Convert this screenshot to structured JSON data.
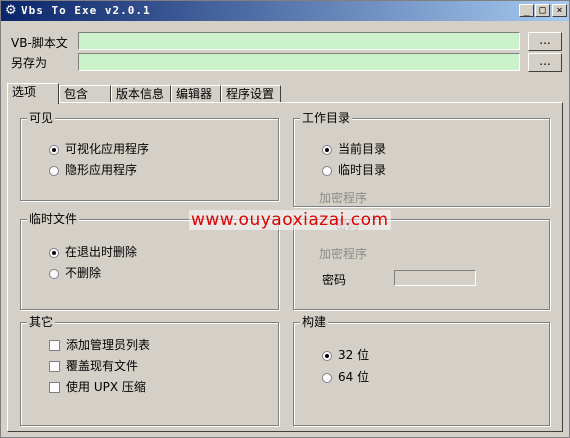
{
  "window": {
    "title": "Vbs To Exe v2.0.1"
  },
  "titlebar": {
    "minimize": "_",
    "maximize": "□",
    "close": "×"
  },
  "script_row": {
    "label": "VB-脚本文",
    "value": "",
    "browse": "..."
  },
  "saveas_row": {
    "label": "另存为",
    "value": "",
    "browse": "..."
  },
  "tabs": [
    "选项",
    "包含",
    "版本信息",
    "编辑器",
    "程序设置"
  ],
  "groups": {
    "visible": {
      "title": "可见",
      "options": [
        {
          "label": "可视化应用程序",
          "checked": true
        },
        {
          "label": "隐形应用程序",
          "checked": false
        }
      ]
    },
    "workdir": {
      "title": "工作目录",
      "options": [
        {
          "label": "当前目录",
          "checked": true
        },
        {
          "label": "临时目录",
          "checked": false
        }
      ]
    },
    "tempfile": {
      "title": "临时文件",
      "options": [
        {
          "label": "在退出时删除",
          "checked": true
        },
        {
          "label": "不删除",
          "checked": false
        }
      ]
    },
    "encrypt": {
      "ghost1": "加密程序",
      "ghost2": "密码",
      "ghost3": "加密程序",
      "password_label": "密码",
      "password_value": ""
    },
    "other": {
      "title": "其它",
      "options": [
        {
          "label": "添加管理员列表"
        },
        {
          "label": "覆盖现有文件"
        },
        {
          "label": "使用 UPX 压缩"
        }
      ]
    },
    "build": {
      "title": "构建",
      "options": [
        {
          "label": "32 位",
          "checked": true
        },
        {
          "label": "64 位",
          "checked": false
        }
      ]
    }
  },
  "watermark": "www.ouyaoxiazai.com"
}
